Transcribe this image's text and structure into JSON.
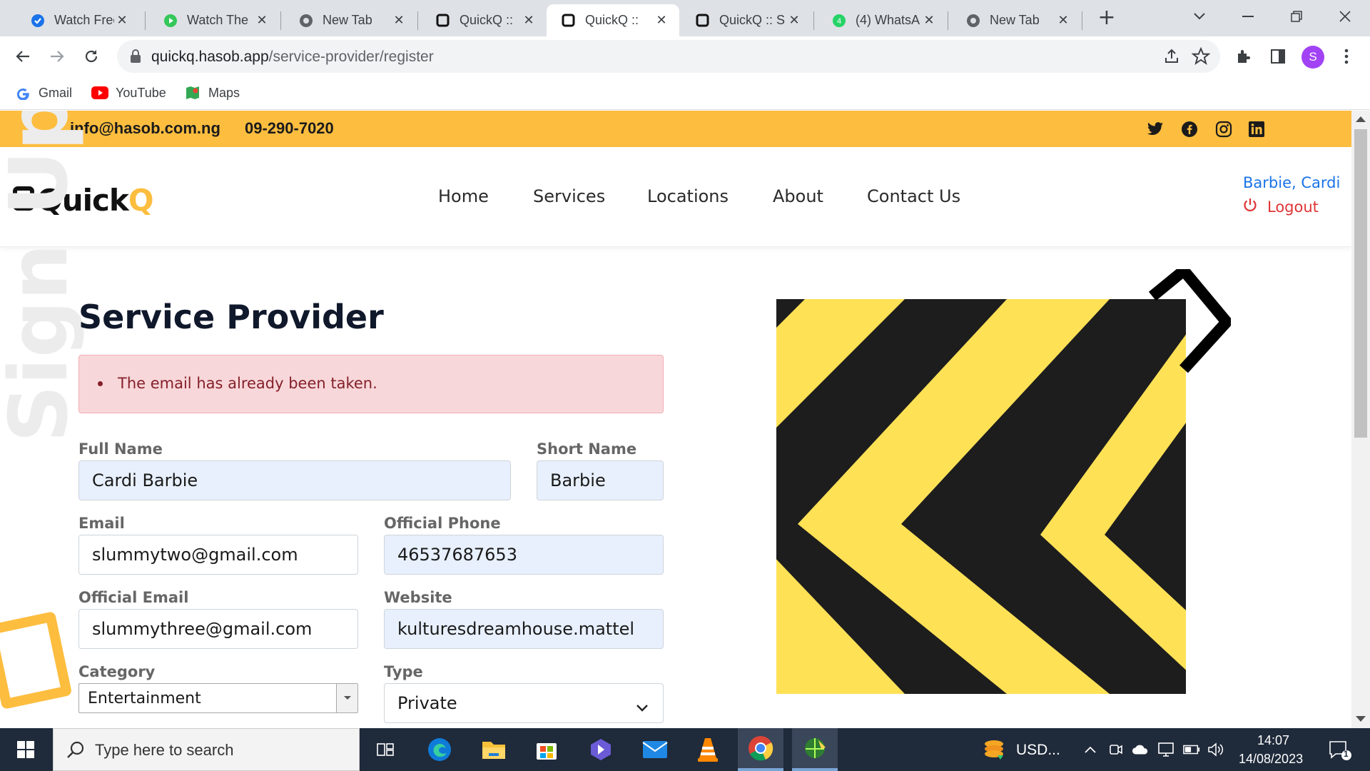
{
  "browser": {
    "tabs": [
      {
        "title": "Watch Free",
        "icon": "blue-check-icon"
      },
      {
        "title": "Watch The",
        "icon": "green-play-icon"
      },
      {
        "title": "New Tab",
        "icon": "chrome-icon"
      },
      {
        "title": "QuickQ ::",
        "icon": "quickq-icon"
      },
      {
        "title": "QuickQ ::",
        "icon": "quickq-icon",
        "active": true
      },
      {
        "title": "QuickQ :: S",
        "icon": "quickq-icon"
      },
      {
        "title": "(4) WhatsA",
        "icon": "whatsapp-icon"
      },
      {
        "title": "New Tab",
        "icon": "chrome-icon"
      }
    ],
    "url_host": "quickq.hasob.app",
    "url_path": "/service-provider/register",
    "profile_initial": "S",
    "bookmarks": [
      "Gmail",
      "YouTube",
      "Maps"
    ]
  },
  "topbar": {
    "email": "info@hasob.com.ng",
    "phone": "09-290-7020",
    "social_icons": [
      "twitter-icon",
      "facebook-icon",
      "instagram-icon",
      "linkedin-icon"
    ]
  },
  "header": {
    "logo_text_a": "Quick",
    "logo_text_b": "Q",
    "nav": [
      "Home",
      "Services",
      "Locations",
      "About",
      "Contact Us"
    ],
    "user_name": "Barbie, Cardi",
    "logout_label": "Logout"
  },
  "decor": {
    "side_text": "Sign Up"
  },
  "form": {
    "title": "Service Provider",
    "error": "The email has already been taken.",
    "full_name": {
      "label": "Full Name",
      "value": "Cardi Barbie"
    },
    "short_name": {
      "label": "Short Name",
      "value": "Barbie"
    },
    "email": {
      "label": "Email",
      "value": "slummytwo@gmail.com"
    },
    "official_phone": {
      "label": "Official Phone",
      "value": "46537687653"
    },
    "official_email": {
      "label": "Official Email",
      "value": "slummythree@gmail.com"
    },
    "website": {
      "label": "Website",
      "value": "kulturesdreamhouse.mattel"
    },
    "category": {
      "label": "Category",
      "value": "Entertainment"
    },
    "type": {
      "label": "Type",
      "value": "Private"
    }
  },
  "colors": {
    "accent": "#fdbd3f",
    "link": "#1a73e8",
    "danger": "#e03434",
    "error_bg": "#f8d7da"
  },
  "taskbar": {
    "search_placeholder": "Type here to search",
    "weather": "USD...",
    "time": "14:07",
    "date": "14/08/2023",
    "notification_count": "1"
  }
}
